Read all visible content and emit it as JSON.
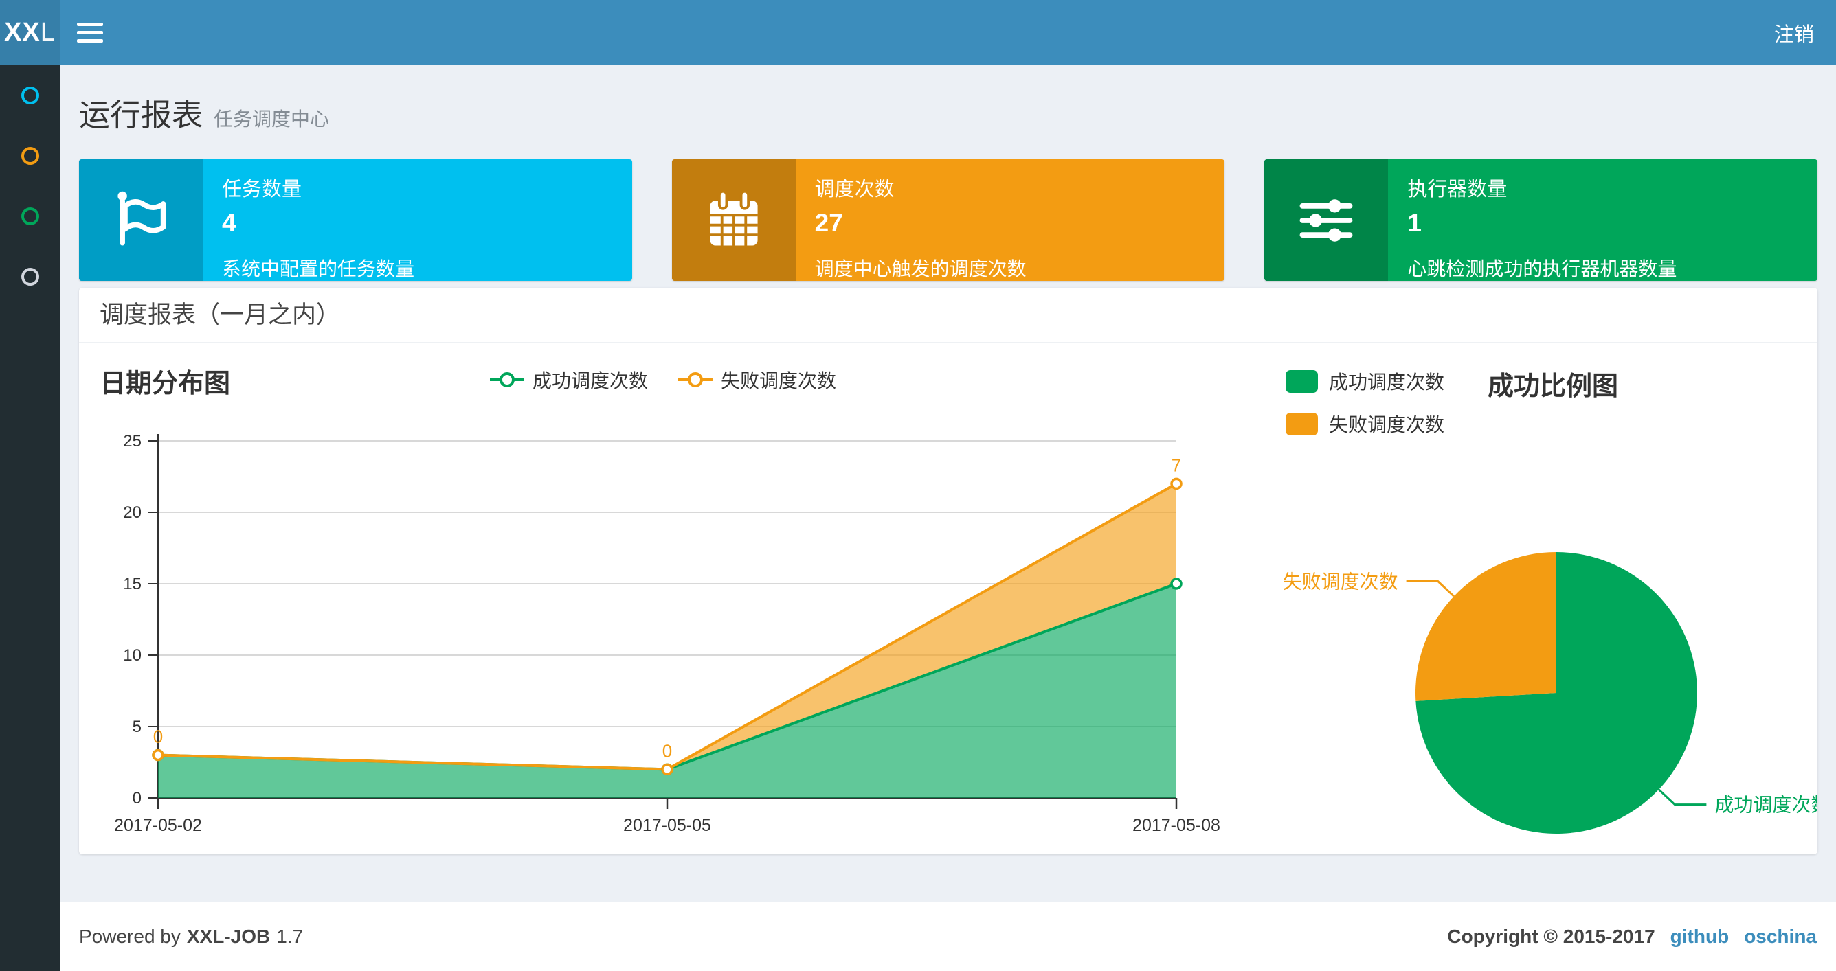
{
  "navbar": {
    "logo": {
      "bold": "XX",
      "light": "L"
    },
    "logout_label": "注销"
  },
  "page_header": {
    "title": "运行报表",
    "subtitle": "任务调度中心"
  },
  "sidebar": {
    "items": [
      {
        "icon": "circle-o-icon",
        "color": "#00c0ef"
      },
      {
        "icon": "circle-o-icon",
        "color": "#f39c12"
      },
      {
        "icon": "circle-o-icon",
        "color": "#00a65a"
      },
      {
        "icon": "circle-o-icon",
        "color": "#d2d6de"
      }
    ]
  },
  "stat_cards": [
    {
      "label": "任务数量",
      "value": "4",
      "description": "系统中配置的任务数量",
      "icon": "flag-icon",
      "bg": "#00c0ef",
      "icon_bg": "#009dc5"
    },
    {
      "label": "调度次数",
      "value": "27",
      "description": "调度中心触发的调度次数",
      "icon": "calendar-icon",
      "bg": "#f39c12",
      "icon_bg": "#c27d0e"
    },
    {
      "label": "执行器数量",
      "value": "1",
      "description": "心跳检测成功的执行器机器数量",
      "icon": "sliders-icon",
      "bg": "#00a65a",
      "icon_bg": "#008548"
    }
  ],
  "panel": {
    "title": "调度报表（一月之内）"
  },
  "chart_data": [
    {
      "type": "area",
      "title": "日期分布图",
      "stacked": true,
      "x": [
        "2017-05-02",
        "2017-05-05",
        "2017-05-08"
      ],
      "series": [
        {
          "name": "成功调度次数",
          "values": [
            3,
            2,
            15
          ],
          "color": "#00a65a"
        },
        {
          "name": "失败调度次数",
          "values": [
            0,
            0,
            7
          ],
          "color": "#f39c12"
        }
      ],
      "point_labels": [
        "0",
        "0",
        "7"
      ],
      "ylim": [
        0,
        25
      ],
      "yticks": [
        0,
        5,
        10,
        15,
        20,
        25
      ],
      "grid": "horizontal",
      "legend_position": "top-center"
    },
    {
      "type": "pie",
      "title": "成功比例图",
      "labels": [
        "成功调度次数",
        "失败调度次数"
      ],
      "values": [
        20,
        7
      ],
      "colors": [
        "#00a65a",
        "#f39c12"
      ],
      "legend_position": "top-left"
    }
  ],
  "footer": {
    "powered_by": "Powered by",
    "product": "XXL-JOB",
    "version": "1.7",
    "copyright": "Copyright © 2015-2017",
    "links": [
      {
        "label": "github"
      },
      {
        "label": "oschina"
      }
    ]
  },
  "colors": {
    "navbar": "#3c8dbc",
    "logo_bg": "#367fa9",
    "sidebar": "#222d32",
    "content_bg": "#ecf0f5",
    "link": "#3c8dbc"
  }
}
